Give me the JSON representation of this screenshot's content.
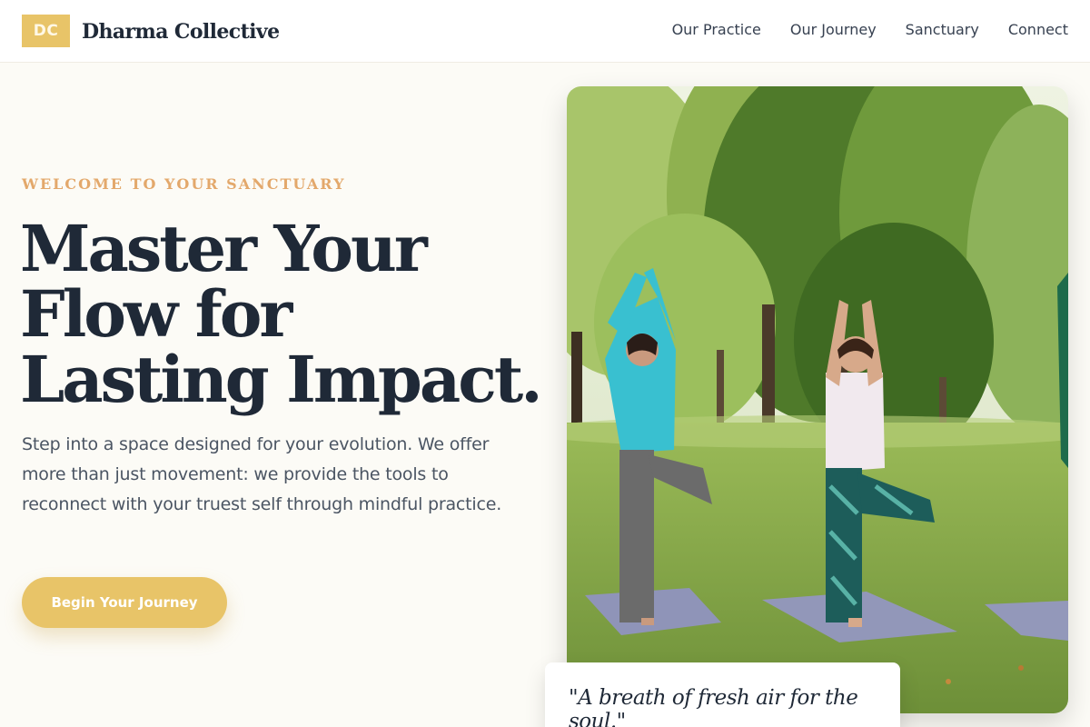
{
  "brand": {
    "badge": "DC",
    "name": "Dharma Collective"
  },
  "nav": {
    "items": [
      {
        "label": "Our Practice"
      },
      {
        "label": "Our Journey"
      },
      {
        "label": "Sanctuary"
      },
      {
        "label": "Connect"
      }
    ]
  },
  "hero": {
    "eyebrow": "WELCOME TO YOUR SANCTUARY",
    "headline": "Master Your Flow for Lasting Impact.",
    "lead": "Step into a space designed for your evolution. We offer more than just movement: we provide the tools to reconnect with your truest self through mindful practice.",
    "cta_label": "Begin Your Journey",
    "quote": "\"A breath of fresh air for the soul.\""
  },
  "colors": {
    "accent": "#e8c468",
    "eyebrow": "#e3a86b",
    "text_dark": "#1f2937",
    "background": "#fcfbf6"
  },
  "icons": {
    "hero_image": "yoga-in-park-photo"
  }
}
